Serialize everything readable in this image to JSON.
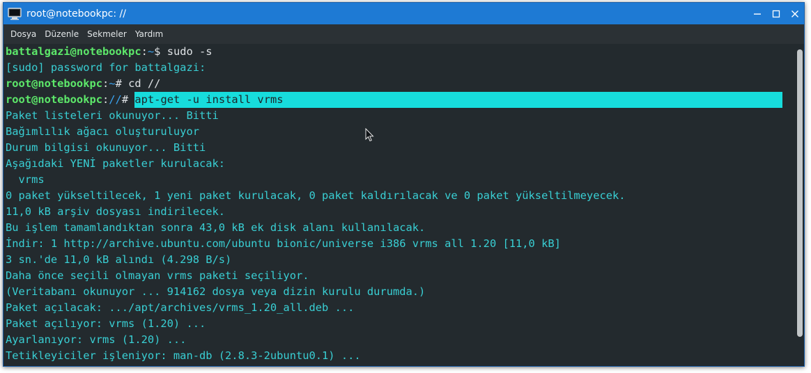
{
  "window": {
    "title": "root@notebookpc: //",
    "title_icon": "terminal-icon",
    "controls": [
      "minimize-icon",
      "maximize-icon",
      "close-icon"
    ]
  },
  "menu": {
    "items": [
      {
        "label": "Dosya"
      },
      {
        "label": "Düzenle"
      },
      {
        "label": "Sekmeler"
      },
      {
        "label": "Yardım"
      }
    ]
  },
  "terminal": {
    "prompt1": {
      "user": "battalgazi@notebookpc",
      "sep": ":",
      "path": "~",
      "sym": "$ ",
      "cmd": "sudo -s"
    },
    "line2": "[sudo] password for battalgazi:",
    "prompt3": {
      "user": "root@notebookpc",
      "sep": ":",
      "path": "~",
      "sym": "# ",
      "cmd": "cd //"
    },
    "prompt4": {
      "user": "root@notebookpc",
      "sep": ":",
      "path": "//",
      "sym": "# ",
      "cmd": "apt-get -u install vrms"
    },
    "output": [
      "Paket listeleri okunuyor... Bitti",
      "Bağımlılık ağacı oluşturuluyor",
      "Durum bilgisi okunuyor... Bitti",
      "Aşağıdaki YENİ paketler kurulacak:",
      "  vrms",
      "0 paket yükseltilecek, 1 yeni paket kurulacak, 0 paket kaldırılacak ve 0 paket yükseltilmeyecek.",
      "11,0 kB arşiv dosyası indirilecek.",
      "Bu işlem tamamlandıktan sonra 43,0 kB ek disk alanı kullanılacak.",
      "İndir: 1 http://archive.ubuntu.com/ubuntu bionic/universe i386 vrms all 1.20 [11,0 kB]",
      "3 sn.'de 11,0 kB alındı (4.298 B/s)",
      "Daha önce seçili olmayan vrms paketi seçiliyor.",
      "(Veritabanı okunuyor ... 914162 dosya veya dizin kurulu durumda.)",
      "Paket açılacak: .../apt/archives/vrms_1.20_all.deb ...",
      "Paket açılıyor: vrms (1.20) ...",
      "Ayarlanıyor: vrms (1.20) ...",
      "Tetikleyiciler işleniyor: man-db (2.8.3-2ubuntu0.1) ..."
    ]
  },
  "colors": {
    "titlebar": "#1e7ad4",
    "background": "#232a2e",
    "output_text": "#39cfd4",
    "user": "#5de86a",
    "path": "#3aa3f0",
    "selection": "#17dcdc"
  }
}
